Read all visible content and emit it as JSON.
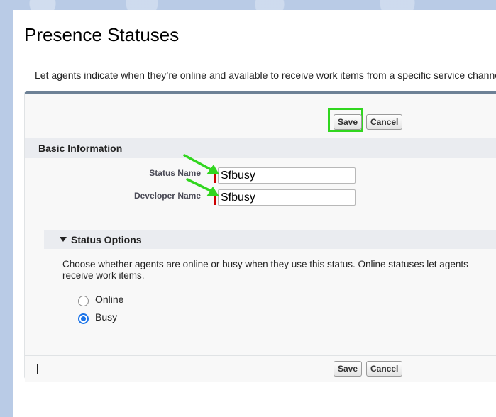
{
  "page": {
    "title": "Presence Statuses",
    "description": "Let agents indicate when they’re online and available to receive work items from a specific service channel, c"
  },
  "toolbar": {
    "save_label": "Save",
    "cancel_label": "Cancel"
  },
  "basic_info": {
    "section_title": "Basic Information",
    "status_name_label": "Status Name",
    "status_name_value": "Sfbusy",
    "developer_name_label": "Developer Name",
    "developer_name_value": "Sfbusy"
  },
  "status_options": {
    "section_title": "Status Options",
    "description": "Choose whether agents are online or busy when they use this status. Online statuses let agents receive work items.",
    "options": [
      {
        "label": "Online",
        "checked": false
      },
      {
        "label": "Busy",
        "checked": true
      }
    ]
  },
  "colors": {
    "highlight": "#31d61f",
    "required": "#cc0000",
    "radio_selected": "#1a73e8"
  }
}
